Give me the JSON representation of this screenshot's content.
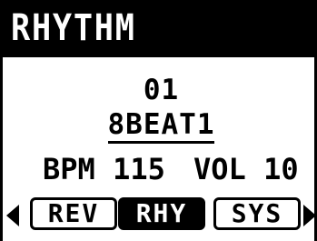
{
  "header": {
    "title": "RHYTHM"
  },
  "pattern": {
    "number": "01",
    "name": "8BEAT1"
  },
  "params": {
    "bpm_label": "BPM",
    "bpm_value": "115",
    "vol_label": "VOL",
    "vol_value": "10"
  },
  "tabs": [
    {
      "label": "REV",
      "active": false
    },
    {
      "label": "RHY",
      "active": true
    },
    {
      "label": "SYS",
      "active": false
    }
  ],
  "icons": {
    "prev": "left-arrow-icon",
    "next": "right-arrow-icon"
  },
  "colors": {
    "foreground": "#000000",
    "background": "#ffffff"
  }
}
